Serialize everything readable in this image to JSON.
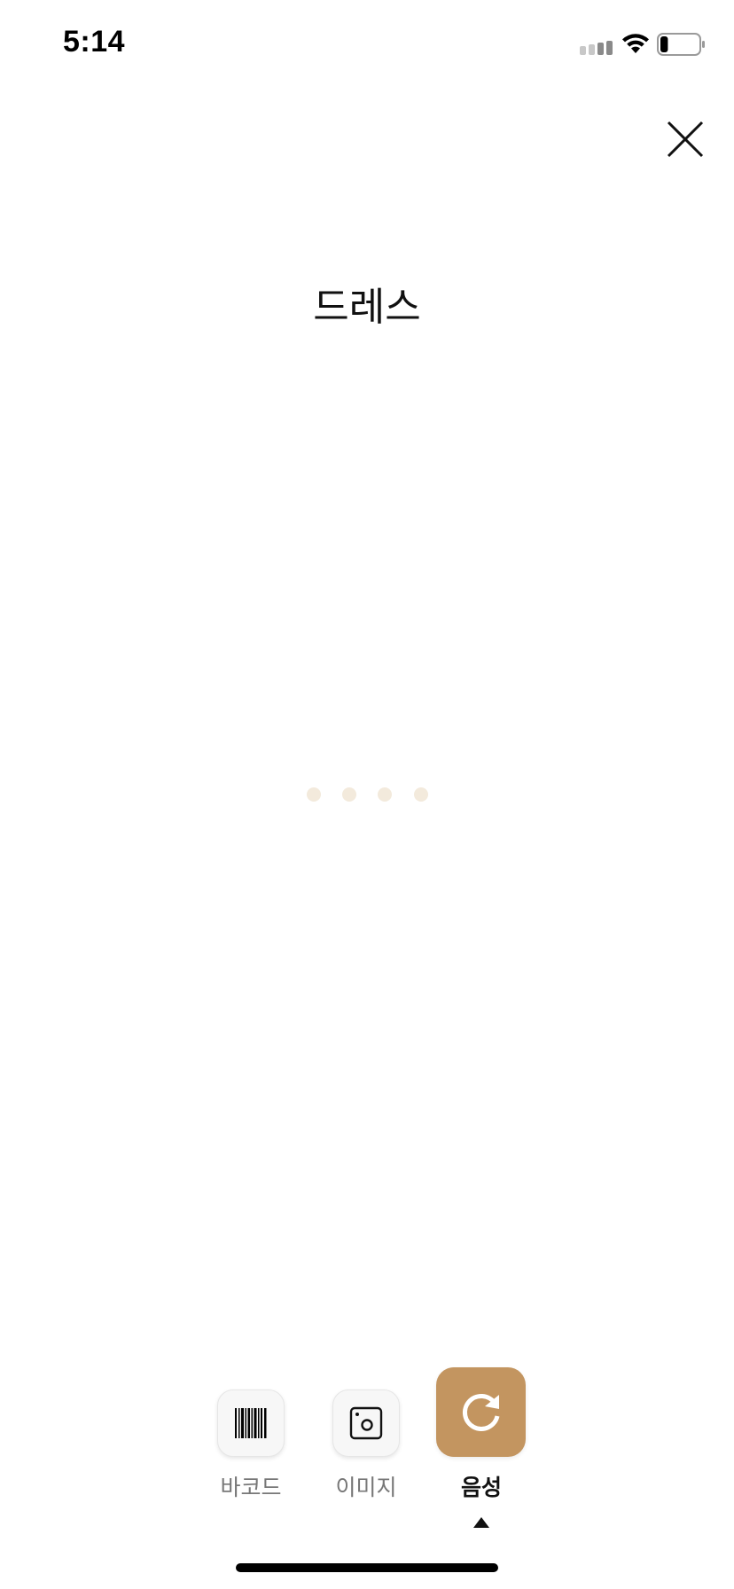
{
  "status_bar": {
    "time": "5:14",
    "signal_icon": "cellular-signal-icon",
    "wifi_icon": "wifi-icon",
    "battery_icon": "battery-icon",
    "battery_level": 0.2
  },
  "close_icon": "close-icon",
  "recognized_text": "드레스",
  "listening_indicator": {
    "dot_color": "#f3eadc",
    "dot_count": 4
  },
  "modes": {
    "barcode": {
      "label": "바코드",
      "icon": "barcode-icon"
    },
    "image": {
      "label": "이미지",
      "icon": "image-camera-icon"
    },
    "voice": {
      "label": "음성",
      "icon": "refresh-icon",
      "selected": true
    }
  },
  "colors": {
    "accent": "#c39560",
    "text": "#111111",
    "muted_label": "#777777"
  }
}
